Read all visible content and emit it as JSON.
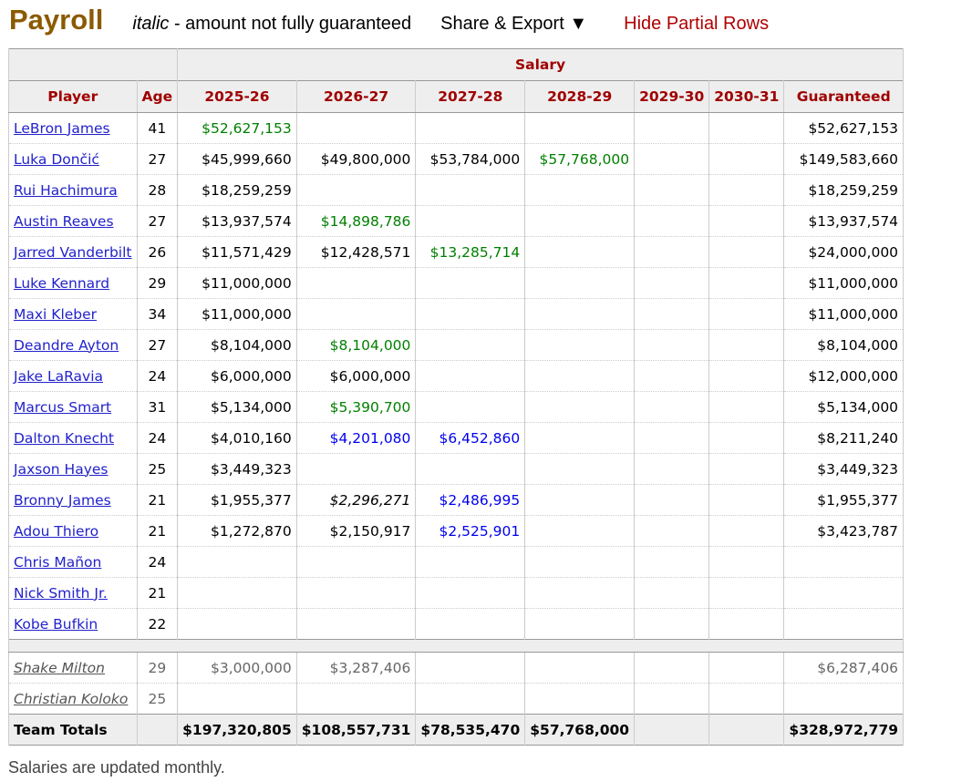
{
  "header": {
    "title": "Payroll",
    "legend_italic": "italic",
    "legend_rest": " - amount not fully guaranteed",
    "share": "Share & Export ▼",
    "hide": "Hide Partial Rows"
  },
  "table": {
    "group": "Salary",
    "columns": [
      "Player",
      "Age",
      "2025-26",
      "2026-27",
      "2027-28",
      "2028-29",
      "2029-30",
      "2030-31",
      "Guaranteed"
    ],
    "colors": {
      "green": "#008000",
      "blue": "#0000ee"
    },
    "rows": [
      {
        "name": "LeBron James",
        "age": "41",
        "s": [
          [
            "$52,627,153",
            "green"
          ],
          [
            "",
            ""
          ],
          [
            "",
            ""
          ],
          [
            "",
            ""
          ],
          [
            "",
            ""
          ],
          [
            "",
            ""
          ]
        ],
        "g": "$52,627,153"
      },
      {
        "name": "Luka Dončić",
        "age": "27",
        "s": [
          [
            "$45,999,660",
            ""
          ],
          [
            "$49,800,000",
            ""
          ],
          [
            "$53,784,000",
            ""
          ],
          [
            "$57,768,000",
            "green"
          ],
          [
            "",
            ""
          ],
          [
            "",
            ""
          ]
        ],
        "g": "$149,583,660"
      },
      {
        "name": "Rui Hachimura",
        "age": "28",
        "s": [
          [
            "$18,259,259",
            ""
          ],
          [
            "",
            ""
          ],
          [
            "",
            ""
          ],
          [
            "",
            ""
          ],
          [
            "",
            ""
          ],
          [
            "",
            ""
          ]
        ],
        "g": "$18,259,259"
      },
      {
        "name": "Austin Reaves",
        "age": "27",
        "s": [
          [
            "$13,937,574",
            ""
          ],
          [
            "$14,898,786",
            "green"
          ],
          [
            "",
            ""
          ],
          [
            "",
            ""
          ],
          [
            "",
            ""
          ],
          [
            "",
            ""
          ]
        ],
        "g": "$13,937,574"
      },
      {
        "name": "Jarred Vanderbilt",
        "age": "26",
        "s": [
          [
            "$11,571,429",
            ""
          ],
          [
            "$12,428,571",
            ""
          ],
          [
            "$13,285,714",
            "green"
          ],
          [
            "",
            ""
          ],
          [
            "",
            ""
          ],
          [
            "",
            ""
          ]
        ],
        "g": "$24,000,000"
      },
      {
        "name": "Luke Kennard",
        "age": "29",
        "s": [
          [
            "$11,000,000",
            ""
          ],
          [
            "",
            ""
          ],
          [
            "",
            ""
          ],
          [
            "",
            ""
          ],
          [
            "",
            ""
          ],
          [
            "",
            ""
          ]
        ],
        "g": "$11,000,000"
      },
      {
        "name": "Maxi Kleber",
        "age": "34",
        "s": [
          [
            "$11,000,000",
            ""
          ],
          [
            "",
            ""
          ],
          [
            "",
            ""
          ],
          [
            "",
            ""
          ],
          [
            "",
            ""
          ],
          [
            "",
            ""
          ]
        ],
        "g": "$11,000,000"
      },
      {
        "name": "Deandre Ayton",
        "age": "27",
        "s": [
          [
            "$8,104,000",
            ""
          ],
          [
            "$8,104,000",
            "green"
          ],
          [
            "",
            ""
          ],
          [
            "",
            ""
          ],
          [
            "",
            ""
          ],
          [
            "",
            ""
          ]
        ],
        "g": "$8,104,000"
      },
      {
        "name": "Jake LaRavia",
        "age": "24",
        "s": [
          [
            "$6,000,000",
            ""
          ],
          [
            "$6,000,000",
            ""
          ],
          [
            "",
            ""
          ],
          [
            "",
            ""
          ],
          [
            "",
            ""
          ],
          [
            "",
            ""
          ]
        ],
        "g": "$12,000,000"
      },
      {
        "name": "Marcus Smart",
        "age": "31",
        "s": [
          [
            "$5,134,000",
            ""
          ],
          [
            "$5,390,700",
            "green"
          ],
          [
            "",
            ""
          ],
          [
            "",
            ""
          ],
          [
            "",
            ""
          ],
          [
            "",
            ""
          ]
        ],
        "g": "$5,134,000"
      },
      {
        "name": "Dalton Knecht",
        "age": "24",
        "s": [
          [
            "$4,010,160",
            ""
          ],
          [
            "$4,201,080",
            "blue"
          ],
          [
            "$6,452,860",
            "blue"
          ],
          [
            "",
            ""
          ],
          [
            "",
            ""
          ],
          [
            "",
            ""
          ]
        ],
        "g": "$8,211,240"
      },
      {
        "name": "Jaxson Hayes",
        "age": "25",
        "s": [
          [
            "$3,449,323",
            ""
          ],
          [
            "",
            ""
          ],
          [
            "",
            ""
          ],
          [
            "",
            ""
          ],
          [
            "",
            ""
          ],
          [
            "",
            ""
          ]
        ],
        "g": "$3,449,323"
      },
      {
        "name": "Bronny James",
        "age": "21",
        "s": [
          [
            "$1,955,377",
            ""
          ],
          [
            "$2,296,271",
            "ital"
          ],
          [
            "$2,486,995",
            "blue"
          ],
          [
            "",
            ""
          ],
          [
            "",
            ""
          ],
          [
            "",
            ""
          ]
        ],
        "g": "$1,955,377"
      },
      {
        "name": "Adou Thiero",
        "age": "21",
        "s": [
          [
            "$1,272,870",
            ""
          ],
          [
            "$2,150,917",
            ""
          ],
          [
            "$2,525,901",
            "blue"
          ],
          [
            "",
            ""
          ],
          [
            "",
            ""
          ],
          [
            "",
            ""
          ]
        ],
        "g": "$3,423,787"
      },
      {
        "name": "Chris Mañon",
        "age": "24",
        "s": [
          [
            "",
            ""
          ],
          [
            "",
            ""
          ],
          [
            "",
            ""
          ],
          [
            "",
            ""
          ],
          [
            "",
            ""
          ],
          [
            "",
            ""
          ]
        ],
        "g": ""
      },
      {
        "name": "Nick Smith Jr.",
        "age": "21",
        "s": [
          [
            "",
            ""
          ],
          [
            "",
            ""
          ],
          [
            "",
            ""
          ],
          [
            "",
            ""
          ],
          [
            "",
            ""
          ],
          [
            "",
            ""
          ]
        ],
        "g": ""
      },
      {
        "name": "Kobe Bufkin",
        "age": "22",
        "s": [
          [
            "",
            ""
          ],
          [
            "",
            ""
          ],
          [
            "",
            ""
          ],
          [
            "",
            ""
          ],
          [
            "",
            ""
          ],
          [
            "",
            ""
          ]
        ],
        "g": ""
      }
    ],
    "partial_rows": [
      {
        "name": "Shake Milton",
        "age": "29",
        "s": [
          [
            "$3,000,000",
            ""
          ],
          [
            "$3,287,406",
            ""
          ],
          [
            "",
            ""
          ],
          [
            "",
            ""
          ],
          [
            "",
            ""
          ],
          [
            "",
            ""
          ]
        ],
        "g": "$6,287,406"
      },
      {
        "name": "Christian Koloko",
        "age": "25",
        "s": [
          [
            "",
            ""
          ],
          [
            "",
            ""
          ],
          [
            "",
            ""
          ],
          [
            "",
            ""
          ],
          [
            "",
            ""
          ],
          [
            "",
            ""
          ]
        ],
        "g": ""
      }
    ],
    "totals": {
      "label": "Team Totals",
      "s": [
        "$197,320,805",
        "$108,557,731",
        "$78,535,470",
        "$57,768,000",
        "",
        ""
      ],
      "g": "$328,972,779"
    }
  },
  "footer": "Salaries are updated monthly."
}
